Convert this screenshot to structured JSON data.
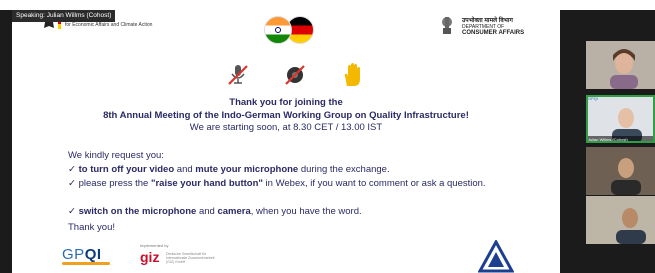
{
  "speaker_banner": "Speaking: Julian Willms (Cohost)",
  "bmwi_logo_text": "for Economic Affairs and Climate Action",
  "dca_logo": {
    "hindi": "उपभोक्ता मामले विभाग",
    "dept": "DEPARTMENT OF",
    "name": "CONSUMER AFFAIRS"
  },
  "slide": {
    "thanks": "Thank you for joining the",
    "meeting": "8th Annual Meeting of the Indo-German Working Group on Quality Infrastructure!",
    "starting": "We are starting soon, at 8.30 CET / 13.00 IST",
    "request_intro": "We kindly request you:",
    "bullets": {
      "b1_bold_a": "to turn off your video",
      "b1_mid": " and ",
      "b1_bold_b": "mute your microphone",
      "b1_end": " during the exchange.",
      "b2_start": "please press the ",
      "b2_bold": "\"raise your hand button\"",
      "b2_end": " in Webex, if you want to comment or ask a question.",
      "b3_bold_a": "switch on the microphone",
      "b3_mid": " and ",
      "b3_bold_b": "camera",
      "b3_end": ", when you have the word."
    },
    "closing": "Thank you!"
  },
  "bottom_logos": {
    "gpqi_a": "GP",
    "gpqi_b": "QI",
    "giz_implemented_by": "Implemented by",
    "giz": "giz",
    "giz_desc": "Deutsche Gesellschaft für Internationale Zusammenarbeit (GIZ) GmbH"
  },
  "participants": [
    {
      "label": ""
    },
    {
      "label": "GPQI",
      "name": "Julian Willms (Cohost)"
    },
    {
      "label": ""
    },
    {
      "label": ""
    }
  ],
  "colors": {
    "slide_text": "#2a2a66",
    "active_speaker_border": "#2ea043",
    "stage_background": "#1b1b1b"
  }
}
